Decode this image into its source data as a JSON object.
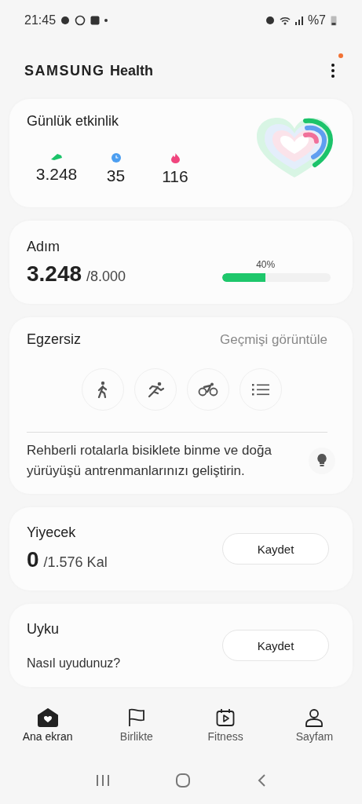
{
  "status_bar": {
    "time": "21:45",
    "battery": "%7"
  },
  "header": {
    "brand": "SAMSUNG",
    "title": "Health",
    "menu_badge": true
  },
  "daily_activity": {
    "title": "Günlük etkinlik",
    "stats": [
      {
        "kind": "steps",
        "value": "3.248"
      },
      {
        "kind": "minutes",
        "value": "35"
      },
      {
        "kind": "calories",
        "value": "116"
      }
    ]
  },
  "steps": {
    "title": "Adım",
    "value": "3.248",
    "goal": "/8.000",
    "percent": "40%",
    "level": 0.4
  },
  "exercise": {
    "title": "Egzersiz",
    "link": "Geçmişi görüntüle",
    "activities": [
      {
        "kind": "walk"
      },
      {
        "kind": "run"
      },
      {
        "kind": "bike"
      },
      {
        "kind": "list"
      }
    ],
    "tip": "Rehberli rotalarla bisiklete binme ve doğa yürüyüşü antrenmanlarınızı geliştirin."
  },
  "food": {
    "title": "Yiyecek",
    "value": "0",
    "goal": "/1.576 Kal",
    "button": "Kaydet"
  },
  "sleep": {
    "title": "Uyku",
    "prompt": "Nasıl uyudunuz?",
    "button": "Kaydet"
  },
  "tabs": [
    {
      "kind": "home",
      "label": "Ana ekran",
      "selected": true
    },
    {
      "kind": "together",
      "label": "Birlikte",
      "selected": false
    },
    {
      "kind": "fitness",
      "label": "Fitness",
      "selected": false
    },
    {
      "kind": "profile",
      "label": "Sayfam",
      "selected": false
    }
  ]
}
